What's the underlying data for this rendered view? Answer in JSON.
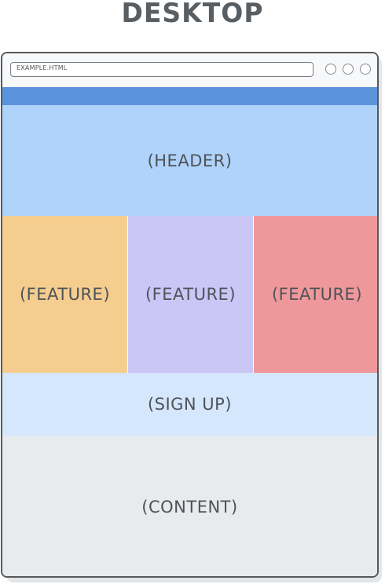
{
  "title": "DESKTOP",
  "browser": {
    "url": "EXAMPLE.HTML",
    "window_buttons": [
      "circle-button",
      "circle-button",
      "circle-button"
    ]
  },
  "sections": {
    "header": "(HEADER)",
    "features": [
      "(FEATURE)",
      "(FEATURE)",
      "(FEATURE)"
    ],
    "signup": "(SIGN UP)",
    "content": "(CONTENT)"
  },
  "colors": {
    "navbar": "#5b93dc",
    "header": "#b0d3fb",
    "feature_1": "#f4cd8f",
    "feature_2": "#cac7f6",
    "feature_3": "#ef989b",
    "signup": "#d5e7fd",
    "content": "#e8ebee"
  }
}
